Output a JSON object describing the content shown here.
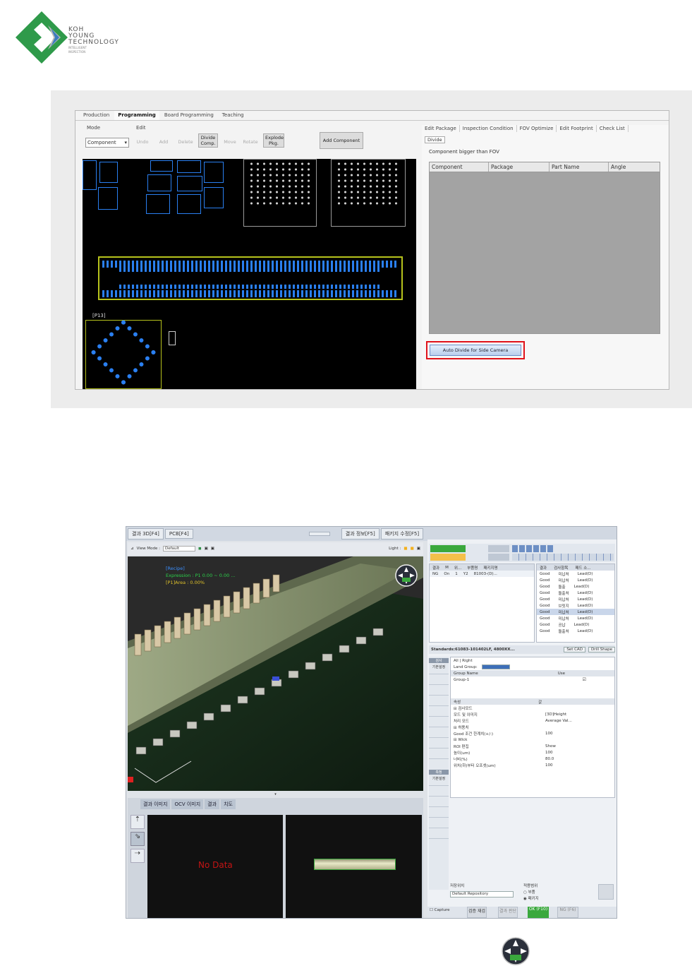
{
  "logo": {
    "line1": "KOH",
    "line2": "YOUNG",
    "line3": "TECHNOLOGY",
    "tagline_1": "INTELLIGENT",
    "tagline_2": "INSPECTION",
    "colors": {
      "green": "#2f9a4a",
      "blue": "#3c7cc0",
      "grey": "#b8b8b8"
    }
  },
  "programming": {
    "tabs": [
      "Production",
      "Programming",
      "Board Programming",
      "Teaching"
    ],
    "active_tab": "Programming",
    "mode_label": "Mode",
    "edit_label": "Edit",
    "mode_select": "Component",
    "edit_buttons": [
      "Undo",
      "Add",
      "Delete",
      "Divide\nComp.",
      "Move",
      "Rotate",
      "Explode\nPkg."
    ],
    "add_component": "Add Component",
    "right_tabs": [
      "Edit Package",
      "Inspection Condition",
      "FOV Optimize",
      "Edit Footprint",
      "Check List"
    ],
    "sub_tab": "Divide",
    "section_title": "Component bigger than FOV",
    "columns": [
      "Component",
      "Package",
      "Part Name",
      "Angle"
    ],
    "auto_divide": "Auto Divide for Side Camera",
    "canvas_label": "[P13]"
  },
  "review": {
    "left_tabs": [
      "결과 3D[F4]",
      "PCB[F4]"
    ],
    "right_tabs": [
      "결과 정보[F5]",
      "패키지 수정[F5]"
    ],
    "toolbar": {
      "view_mode_label": "View Mode :",
      "view_mode": "Default",
      "light_label": "Light :"
    },
    "overlay": {
      "line1": "[Recipe]",
      "line2": "Expression :  P1   0.00 ~ 0.00 ...",
      "line3": "[P1]Area :   0.00%"
    },
    "lower_tabs": [
      "결과 이미지",
      "OCV 이미지",
      "결과",
      "치도"
    ],
    "no_data": "No Data",
    "result_cols": [
      "결과",
      "M",
      "위...",
      "부품명",
      "패키지명"
    ],
    "result_row": [
      "NG",
      "On",
      "1",
      "Y2",
      "81003-(D)..."
    ],
    "detail_cols": [
      "결과",
      "검사항목",
      "패드 소..."
    ],
    "detail_rows": [
      [
        "Good",
        "미납처",
        "Lead(D)"
      ],
      [
        "Good",
        "미납처",
        "Lead(D)"
      ],
      [
        "Good",
        "돌출",
        "Lead(D)"
      ],
      [
        "Good",
        "돌출처",
        "Lead(D)"
      ],
      [
        "Good",
        "미납처",
        "Lead(D)"
      ],
      [
        "Good",
        "브릿지",
        "Lead(D)"
      ],
      [
        "Good",
        "미납처",
        "Lead(D)"
      ],
      [
        "Good",
        "미납처",
        "Lead(D)"
      ],
      [
        "Good",
        "공납",
        "Lead(D)"
      ],
      [
        "Good",
        "돌출처",
        "Lead(D)"
      ]
    ],
    "standards": "Standards:61083-101402LF, 4800XX...",
    "set_cad": "Set CAD",
    "drill_shape": "Drill Shape",
    "all_right": "All | Right",
    "land_group_label": "Land Group:",
    "group_name_header": "Group Name",
    "use_header": "Use",
    "group_row": "Group-1",
    "prop_header": "속성",
    "value_header": "값",
    "props": [
      [
        "⊟ 검사모드",
        ""
      ],
      [
        "  모드 및 이미지",
        "[3D]Height"
      ],
      [
        "  처리 모드",
        "Average Val..."
      ],
      [
        "⊟ 허용치",
        ""
      ],
      [
        "  Good 조건 한계치(+/-)",
        "100"
      ],
      [
        "⊟ Wick",
        ""
      ],
      [
        "  ROI 편집",
        "Show"
      ],
      [
        "  높이(um)",
        "100"
      ],
      [
        "  너비(%)",
        "80.0"
      ],
      [
        "  위치(하)부터 오프셋(um)",
        "100"
      ]
    ],
    "side_labels": [
      "검사",
      "기본설정",
      "측정",
      "기본설정"
    ],
    "repository_label": "저장위치",
    "repository": "Default Repository",
    "apply_label": "적용범위",
    "radio1": "부품",
    "radio2": "패키지",
    "capture": "Capture",
    "bottom_btns": [
      "검증 재검",
      "결과 판단",
      "OK (F10)",
      "NG (F6)"
    ],
    "ok_color": "#3aa83d"
  }
}
